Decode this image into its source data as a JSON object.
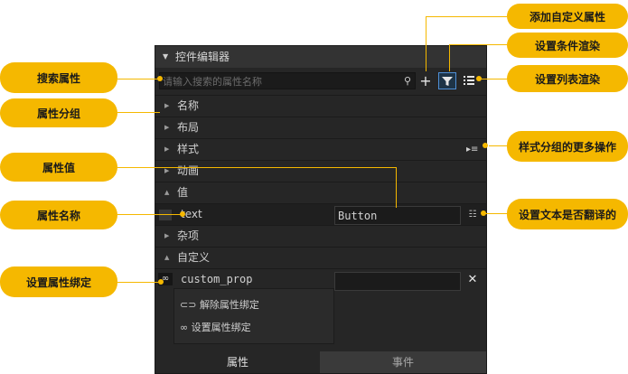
{
  "panel": {
    "title": "控件编辑器",
    "search_placeholder": "请输入搜索的属性名称",
    "groups": [
      {
        "label": "名称",
        "expanded": false
      },
      {
        "label": "布局",
        "expanded": false
      },
      {
        "label": "样式",
        "expanded": false
      },
      {
        "label": "动画",
        "expanded": false
      },
      {
        "label": "值",
        "expanded": true
      },
      {
        "label": "杂项",
        "expanded": false
      },
      {
        "label": "自定义",
        "expanded": true
      }
    ],
    "text_prop": {
      "name": "text",
      "value": "Button"
    },
    "custom_prop": {
      "name": "custom_prop",
      "value": ""
    },
    "popup": {
      "unbind": "解除属性绑定",
      "bind": "设置属性绑定"
    },
    "tabs": {
      "properties": "属性",
      "events": "事件"
    }
  },
  "callouts": {
    "add_custom": "添加自定义属性",
    "condition_render": "设置条件渲染",
    "list_render": "设置列表渲染",
    "search_prop": "搜索属性",
    "prop_group": "属性分组",
    "more_actions": "样式分组的更多操作",
    "prop_value": "属性值",
    "prop_name": "属性名称",
    "translate": "设置文本是否翻译的",
    "prop_binding": "设置属性绑定"
  },
  "colors": {
    "accent": "#f5b800",
    "panel_bg": "#262626",
    "selected_border": "#4f8fd6"
  }
}
